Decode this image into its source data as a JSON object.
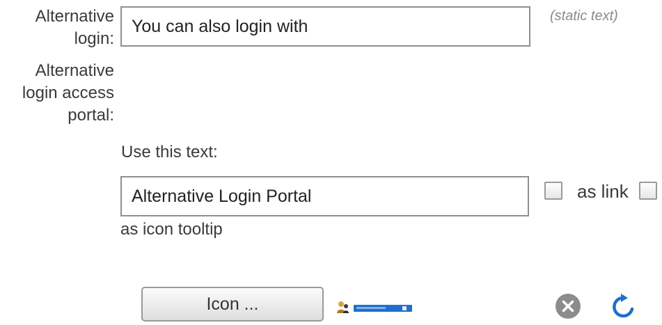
{
  "form": {
    "alternative_login": {
      "label": "Alternative login:",
      "value": "You can also login with",
      "hint": "(static text)"
    },
    "alternative_login_access_portal": {
      "label": "Alternative login access portal:",
      "use_text_label": "Use this text:",
      "text_value": "Alternative Login Portal",
      "as_link_label": "as link",
      "as_link_checked": false,
      "as_icon_tooltip_checked": false,
      "as_icon_tooltip_label": "as icon tooltip"
    },
    "icon": {
      "button_label": "Icon ...",
      "preview_icon": "user-login-banner-icon"
    },
    "actions": {
      "delete_icon": "x-circle-icon",
      "reset_icon": "refresh-icon"
    }
  },
  "colors": {
    "text": "#333333",
    "hint": "#8a8a8a",
    "border": "#8f8f8f",
    "accent_blue": "#1e6fd0",
    "delete_gray": "#8c8c8c"
  }
}
